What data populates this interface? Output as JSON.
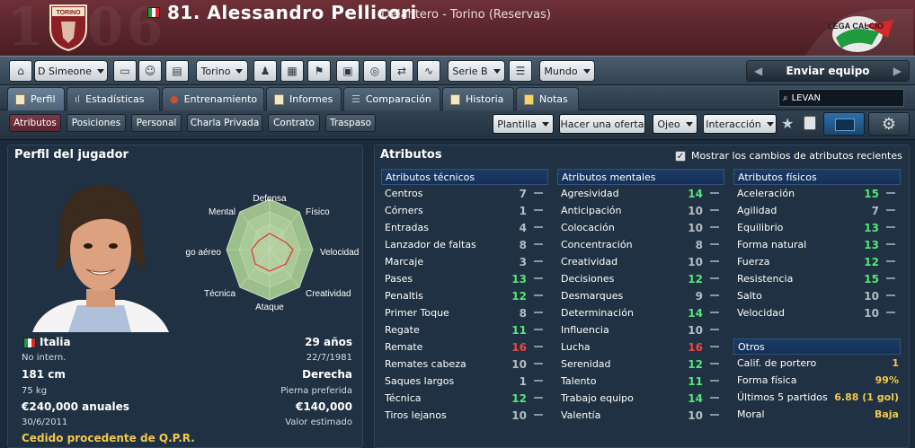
{
  "header": {
    "number_name": "81. Alessandro Pellicori",
    "subtitle": "Delantero - Torino (Reservas)",
    "club_crest_text": "TORINO",
    "watermark": "1906",
    "league_logo_text": "LEGA CALCIO"
  },
  "toolbar": {
    "manager": "D Simeone",
    "club": "Torino",
    "league": "Serie B",
    "world": "Mundo",
    "send_team": "Enviar equipo"
  },
  "tabs": [
    "Perfil",
    "Estadísticas",
    "Entrenamiento",
    "Informes",
    "Comparación",
    "Historia",
    "Notas"
  ],
  "search": {
    "value": "LEVAN"
  },
  "subtabs": [
    "Atributos",
    "Posiciones",
    "Personal",
    "Charla Privada",
    "Contrato",
    "Traspaso"
  ],
  "actions": {
    "squad": "Plantilla",
    "offer": "Hacer una oferta",
    "scout": "Ojeo",
    "interaction": "Interacción"
  },
  "profile": {
    "title": "Perfil del jugador",
    "radar_labels": [
      "Defensa",
      "Físico",
      "Velocidad",
      "Creatividad",
      "Ataque",
      "Técnica",
      "Juego aéreo",
      "Mental"
    ],
    "nation": "Italia",
    "intl": "No intern.",
    "age": "29 años",
    "dob": "22/7/1981",
    "height": "181 cm",
    "weight": "75 kg",
    "foot": "Derecha",
    "foot_label": "Pierna preferida",
    "wage": "€240,000 anuales",
    "contract_end": "30/6/2011",
    "value": "€140,000",
    "value_label": "Valor estimado",
    "loan": "Cedido procedente de Q.P.R."
  },
  "attributes": {
    "title": "Atributos",
    "show_changes": "Mostrar los cambios de atributos recientes",
    "technical_title": "Atributos técnicos",
    "mental_title": "Atributos mentales",
    "physical_title": "Atributos físicos",
    "others_title": "Otros",
    "technical": [
      {
        "name": "Centros",
        "value": "7"
      },
      {
        "name": "Córners",
        "value": "1"
      },
      {
        "name": "Entradas",
        "value": "4"
      },
      {
        "name": "Lanzador de faltas",
        "value": "8"
      },
      {
        "name": "Marcaje",
        "value": "3"
      },
      {
        "name": "Pases",
        "value": "13"
      },
      {
        "name": "Penaltis",
        "value": "12"
      },
      {
        "name": "Primer Toque",
        "value": "8"
      },
      {
        "name": "Regate",
        "value": "11"
      },
      {
        "name": "Remate",
        "value": "16"
      },
      {
        "name": "Remates cabeza",
        "value": "10"
      },
      {
        "name": "Saques largos",
        "value": "1"
      },
      {
        "name": "Técnica",
        "value": "12"
      },
      {
        "name": "Tiros lejanos",
        "value": "10"
      }
    ],
    "mental": [
      {
        "name": "Agresividad",
        "value": "14"
      },
      {
        "name": "Anticipación",
        "value": "10"
      },
      {
        "name": "Colocación",
        "value": "10"
      },
      {
        "name": "Concentración",
        "value": "8"
      },
      {
        "name": "Creatividad",
        "value": "10"
      },
      {
        "name": "Decisiones",
        "value": "12"
      },
      {
        "name": "Desmarques",
        "value": "9"
      },
      {
        "name": "Determinación",
        "value": "14"
      },
      {
        "name": "Influencia",
        "value": "10"
      },
      {
        "name": "Lucha",
        "value": "16"
      },
      {
        "name": "Serenidad",
        "value": "12"
      },
      {
        "name": "Talento",
        "value": "11"
      },
      {
        "name": "Trabajo equipo",
        "value": "14"
      },
      {
        "name": "Valentía",
        "value": "10"
      }
    ],
    "physical": [
      {
        "name": "Aceleración",
        "value": "15"
      },
      {
        "name": "Agilidad",
        "value": "7"
      },
      {
        "name": "Equilibrio",
        "value": "13"
      },
      {
        "name": "Forma natural",
        "value": "13"
      },
      {
        "name": "Fuerza",
        "value": "12"
      },
      {
        "name": "Resistencia",
        "value": "15"
      },
      {
        "name": "Salto",
        "value": "10"
      },
      {
        "name": "Velocidad",
        "value": "10"
      }
    ],
    "others": [
      {
        "name": "Calif. de portero",
        "value": "1"
      },
      {
        "name": "Forma física",
        "value": "99%"
      },
      {
        "name": "Últimos 5 partidos",
        "value": "6.88 (1 gol)"
      },
      {
        "name": "Moral",
        "value": "Baja"
      }
    ]
  },
  "colors": {
    "high": "#56e37c",
    "mid": "#b4bcc4",
    "red": "#f04545",
    "gold": "#f2c94c",
    "header": "#5a252c"
  }
}
